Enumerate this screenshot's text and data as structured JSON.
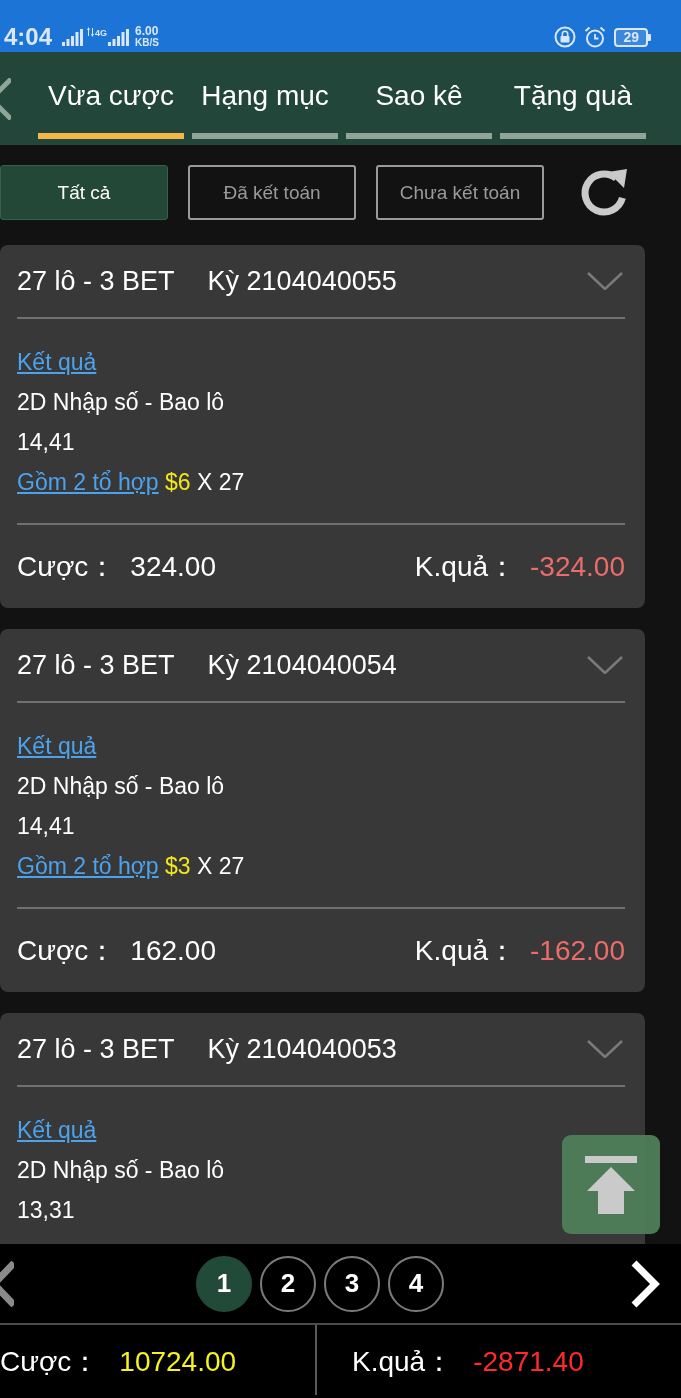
{
  "status_bar": {
    "time": "4:04",
    "network": "4G",
    "speed": "6.00",
    "speed_unit": "KB/S",
    "battery": "29"
  },
  "tabs": [
    {
      "label": "Vừa cược",
      "selected": true
    },
    {
      "label": "Hạng mục",
      "selected": false
    },
    {
      "label": "Sao kê",
      "selected": false
    },
    {
      "label": "Tặng quà",
      "selected": false
    }
  ],
  "filters": [
    {
      "label": "Tất cả",
      "selected": true
    },
    {
      "label": "Đã kết toán",
      "selected": false
    },
    {
      "label": "Chưa kết toán",
      "selected": false
    }
  ],
  "bets": [
    {
      "title": "27 lô - 3 BET",
      "period": "Kỳ 2104040055",
      "result_link": "Kết quả",
      "game": "2D Nhập số - Bao lô",
      "numbers": "14,41",
      "combos_link": "Gồm 2 tổ hợp",
      "unit_stake": "$6",
      "multiplier": "X 27",
      "stake_label": "Cược：",
      "stake": "324.00",
      "result_label": "K.quả：",
      "result": "-324.00"
    },
    {
      "title": "27 lô - 3 BET",
      "period": "Kỳ 2104040054",
      "result_link": "Kết quả",
      "game": "2D Nhập số - Bao lô",
      "numbers": "14,41",
      "combos_link": "Gồm 2 tổ hợp",
      "unit_stake": "$3",
      "multiplier": "X 27",
      "stake_label": "Cược：",
      "stake": "162.00",
      "result_label": "K.quả：",
      "result": "-162.00"
    },
    {
      "title": "27 lô - 3 BET",
      "period": "Kỳ 2104040053",
      "result_link": "Kết quả",
      "game": "2D Nhập số - Bao lô",
      "numbers": "13,31"
    }
  ],
  "pagination": {
    "pages": [
      {
        "label": "1",
        "selected": true
      },
      {
        "label": "2",
        "selected": false
      },
      {
        "label": "3",
        "selected": false
      },
      {
        "label": "4",
        "selected": false
      }
    ]
  },
  "totals": {
    "stake_label": "Cược：",
    "stake": "10724.00",
    "result_label": "K.quả：",
    "result": "-2871.40"
  }
}
